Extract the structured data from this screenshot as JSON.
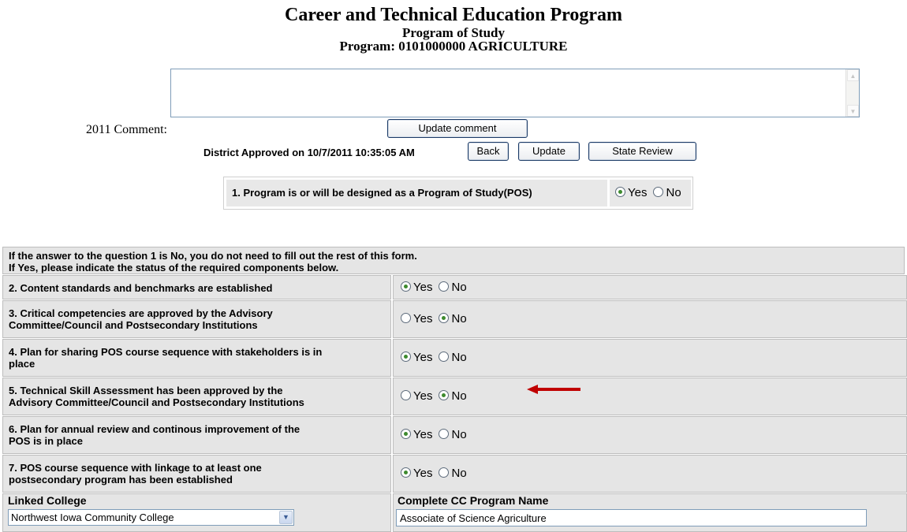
{
  "header": {
    "title": "Career and Technical Education Program",
    "subtitle": "Program of Study",
    "program": "Program: 0101000000  AGRICULTURE"
  },
  "comment": {
    "label": "2011 Comment:",
    "value": "",
    "update_button": "Update comment"
  },
  "status": {
    "approved_text": "District Approved on 10/7/2011 10:35:05 AM",
    "back_button": "Back",
    "update_button": "Update",
    "state_review_button": "State Review"
  },
  "question1": {
    "text": "1. Program is or will be designed as a Program of Study(POS)",
    "yes": "Yes",
    "no": "No",
    "selected": "Yes"
  },
  "intro": {
    "line1": "If the answer to the question 1 is No, you do not need to fill out the rest of this form.",
    "line2": "If Yes, please indicate the status of the required components below."
  },
  "options": {
    "yes": "Yes",
    "no": "No"
  },
  "questions": [
    {
      "line1": "2. Content standards and benchmarks are established",
      "line2": "",
      "selected": "Yes"
    },
    {
      "line1": "3. Critical competencies are approved by the Advisory",
      "line2": "Committee/Council and Postsecondary Institutions",
      "selected": "No"
    },
    {
      "line1": "4. Plan for sharing POS course sequence with stakeholders is in",
      "line2": "place",
      "selected": "Yes"
    },
    {
      "line1": "5. Technical Skill Assessment has been approved by the",
      "line2": "Advisory Committee/Council and Postsecondary Institutions",
      "selected": "No"
    },
    {
      "line1": "6. Plan for annual review and continous improvement of the",
      "line2": "POS is in place",
      "selected": "Yes"
    },
    {
      "line1": "7. POS course sequence with linkage to at least one",
      "line2": "postsecondary program has been established",
      "selected": "Yes"
    }
  ],
  "linked": {
    "college_label": "Linked College",
    "college_value": "Northwest Iowa Community College",
    "program_label": "Complete CC Program Name",
    "program_value": "Associate of Science Agriculture"
  },
  "colors": {
    "arrow": "#c00000",
    "cell_bg": "#e5e5e5",
    "radio_dot": "#3d8a2e"
  }
}
